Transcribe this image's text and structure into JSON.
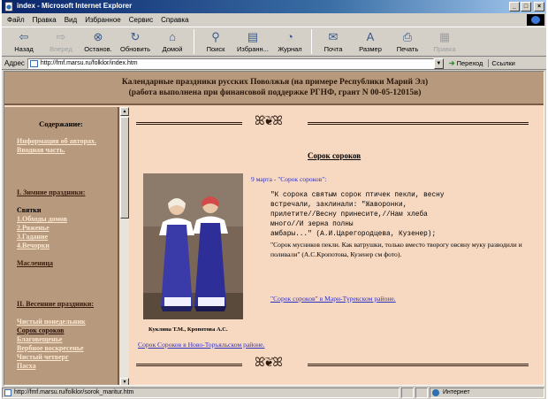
{
  "window": {
    "title": "index - Microsoft Internet Explorer",
    "controls": [
      "_",
      "□",
      "×"
    ]
  },
  "menu": [
    "Файл",
    "Правка",
    "Вид",
    "Избранное",
    "Сервис",
    "Справка"
  ],
  "toolbar": {
    "back": "Назад",
    "forward": "Вперед",
    "stop": "Останов.",
    "refresh": "Обновить",
    "home": "Домой",
    "search": "Поиск",
    "favorites": "Избранн...",
    "history": "Журнал",
    "mail": "Почта",
    "size": "Размер",
    "print": "Печать",
    "edit": "Правка"
  },
  "address": {
    "label": "Адрес",
    "url": "http://fmf.marsu.ru/folklor/index.htm",
    "go": "Переход",
    "links": "Ссылки"
  },
  "page": {
    "banner_line1": "Календарные праздники русских Поволжья (на примере Республики Марий Эл)",
    "banner_line2": "(работа выполнена при финансовой поддержке РГНФ, грант N 00-05-12015в)",
    "sidebar": {
      "title": "Содержание:",
      "author_info": "Информация об авторах.",
      "intro": "Вводная часть.",
      "winter_header": "I. Зимние праздники:",
      "svyatki": "Святки",
      "svyatki_items": [
        "1.Обходы домов",
        "2.Ряженье",
        "3.Гадание",
        "4.Вечорки"
      ],
      "maslenitsa": "Масленица",
      "spring_header": "II. Весенние праздники:",
      "spring_items": [
        "Чистый понедельник",
        "Сорок сороков",
        "Благовещенье",
        "Вербное воскресенье",
        "Чистый четверг",
        "Пасха"
      ]
    },
    "ornament": "ꕤ❦ꕤ",
    "article_title": "Сорок сороков",
    "date_line": "9 марта - \"Сорок сороков\":",
    "poem": "\"К сорока святым сорок птичек пекли, весну\nвстречали, заклинали: \"Жаворонки,\nприлетите//Весну принесите,//Нам хлеба\nмного//И зерна полны\nамбары...\" (А.И.Царегородцева, Кузенер);",
    "prose": "\"Сорок мусников пекли. Как ватрушки, только вместо творогу овсяну муку разводили и поливали\" (А.С.Кропотова, Кузенер см фото).",
    "mari_link": "\"Сорок сороков\" в Мари-Турекском районе.",
    "photo_caption": "Куклина Т.М., Кропотова А.С.",
    "novo_link": "Сорок Сороков в Ново-Торъяльском районе."
  },
  "status": {
    "url": "http://fmf.marsu.ru/folklor/sorok_maritur.htm",
    "zone": "Интернет"
  },
  "colors": {
    "page_bg": "#f7d9c2",
    "sidebar_bg": "#b79a7e",
    "link": "#3030c0",
    "sidebar_link": "#fbe6cf"
  }
}
